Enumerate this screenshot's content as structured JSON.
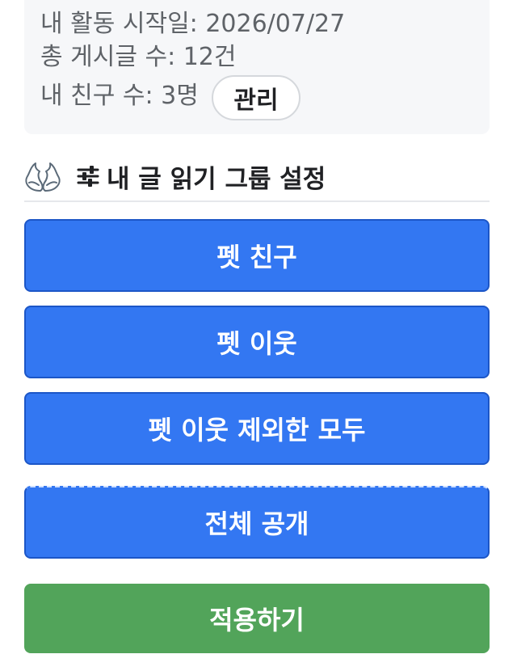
{
  "profile": {
    "start_date_line": "내 활동 시작일: 2026/07/27",
    "post_count_line": "총 게시글 수: 12건",
    "friend_count_line": "내 친구 수: 3명",
    "manage_label": "관리"
  },
  "section": {
    "title": "내 글 읽기 그룹 설정",
    "icons": [
      "angel-wings-icon",
      "sliders-icon"
    ]
  },
  "groups": [
    {
      "label": "펫 친구"
    },
    {
      "label": "펫 이웃"
    },
    {
      "label": "펫 이웃 제외한 모두"
    },
    {
      "label": "전체 공개"
    }
  ],
  "apply_label": "적용하기",
  "colors": {
    "group_button": "#3377f2",
    "apply_button": "#52a45a",
    "card_background": "#f6f7f9"
  }
}
